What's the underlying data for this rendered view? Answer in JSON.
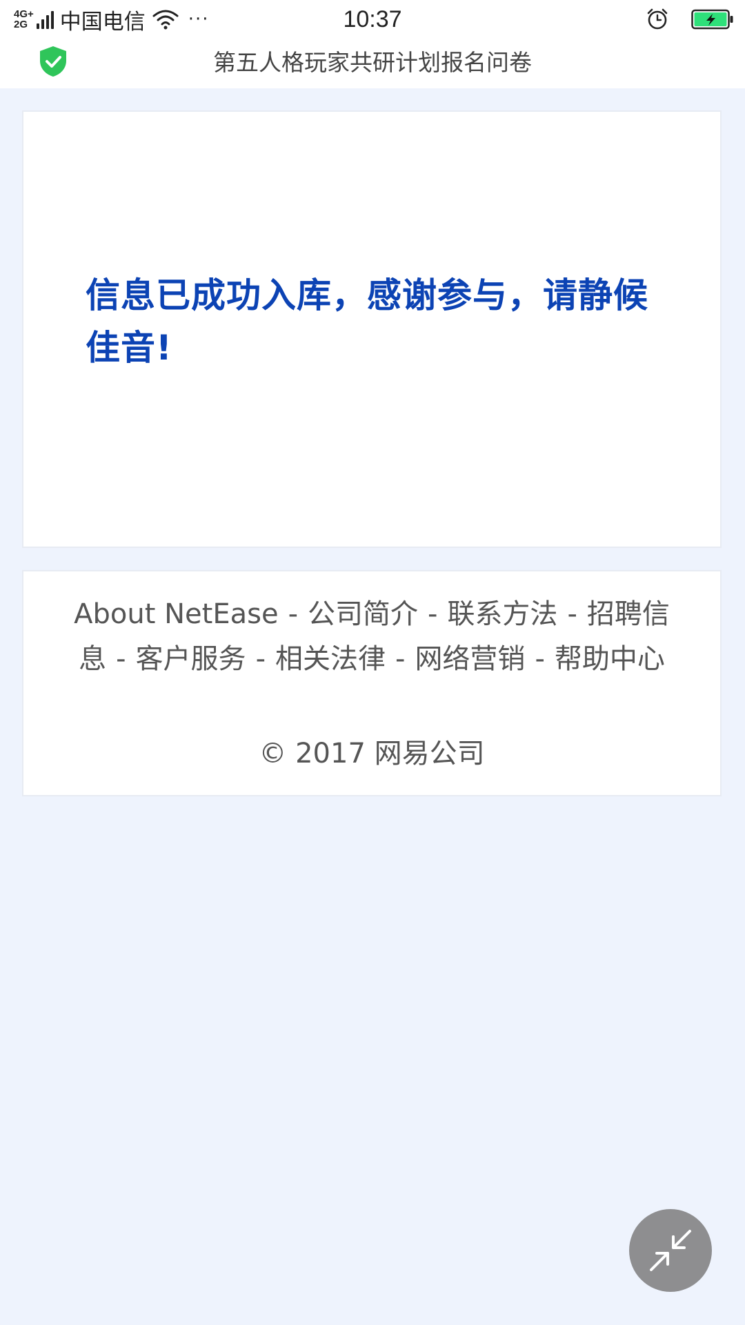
{
  "status_bar": {
    "network_top": "4G+",
    "network_bottom": "2G",
    "carrier": "中国电信",
    "more": "···",
    "time": "10:37",
    "icons": [
      "wifi-icon",
      "alarm-icon",
      "battery-charging-icon"
    ],
    "battery_color": "#2ee07a"
  },
  "nav": {
    "title": "第五人格玩家共研计划报名问卷",
    "shield_color": "#2fc55a"
  },
  "message": {
    "text": "信息已成功入库，感谢参与，请静候佳音!",
    "color": "#0c43b4"
  },
  "footer": {
    "links": [
      "About NetEase",
      "公司简介",
      "联系方法",
      "招聘信息",
      "客户服务",
      "相关法律",
      "网络营销",
      "帮助中心"
    ],
    "separator": "-",
    "copyright": "© 2017 网易公司"
  },
  "float_button": {
    "icon": "minimize-arrows-icon",
    "color": "#8e8e90"
  }
}
